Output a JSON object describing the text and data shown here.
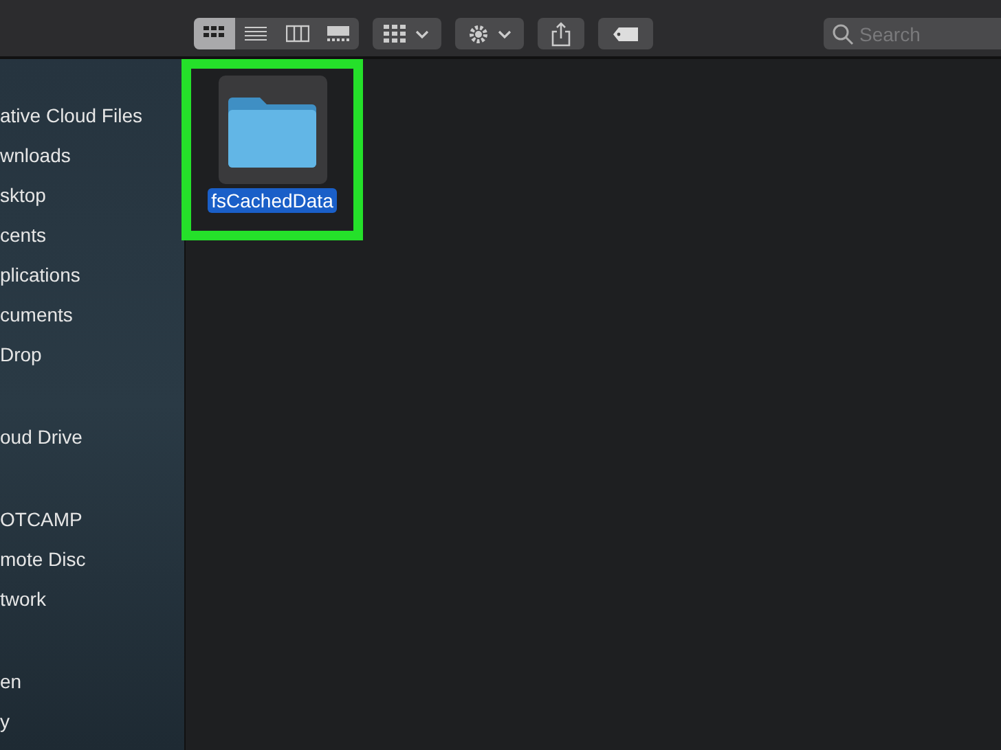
{
  "toolbar": {
    "view_modes": [
      {
        "kind": "icons",
        "selected": true
      },
      {
        "kind": "list",
        "selected": false
      },
      {
        "kind": "columns",
        "selected": false
      },
      {
        "kind": "gallery",
        "selected": false
      }
    ],
    "search": {
      "placeholder": "Search"
    }
  },
  "sidebar": {
    "sections": [
      {
        "items": [
          {
            "label": "ative Cloud Files"
          },
          {
            "label": "wnloads"
          },
          {
            "label": "sktop"
          },
          {
            "label": "cents"
          },
          {
            "label": "plications"
          },
          {
            "label": "cuments"
          },
          {
            "label": "Drop"
          }
        ]
      },
      {
        "items": [
          {
            "label": "oud Drive"
          }
        ]
      },
      {
        "items": [
          {
            "label": "OTCAMP"
          },
          {
            "label": "mote Disc"
          },
          {
            "label": "twork"
          }
        ]
      },
      {
        "items": [
          {
            "label": "en"
          },
          {
            "label": "y"
          }
        ]
      }
    ]
  },
  "files": [
    {
      "name": "fsCachedData",
      "selected": true,
      "highlighted": true
    }
  ]
}
